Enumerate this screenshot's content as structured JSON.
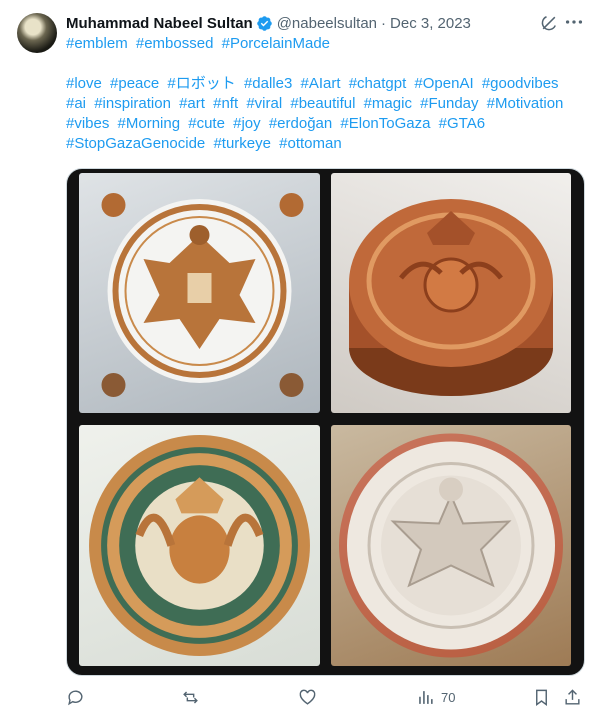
{
  "author": {
    "name": "Muhammad Nabeel Sultan",
    "handle": "@nabeelsultan",
    "date": "Dec 3, 2023",
    "dot": "·"
  },
  "post": {
    "hashtags_line1": [
      "#emblem",
      "#embossed",
      "#PorcelainMade"
    ],
    "hashtags_rest": [
      "#love",
      "#peace",
      "#ロボット",
      "#dalle3",
      "#AIart",
      "#chatgpt",
      "#OpenAI",
      "#goodvibes",
      "#ai",
      "#inspiration",
      "#art",
      "#nft",
      "#viral",
      "#beautiful",
      "#magic",
      "#Funday",
      "#Motivation",
      "#vibes",
      "#Morning",
      "#cute",
      "#joy",
      "#erdoğan",
      "#ElonToGaza",
      "#GTA6",
      "#StopGazaGenocide",
      "#turkeye",
      "#ottoman"
    ]
  },
  "actions": {
    "views": "70"
  },
  "colors": {
    "link": "#1d9bf0",
    "muted": "#536471",
    "verified": "#1d9bf0"
  },
  "icons": [
    "verified-badge-icon",
    "grok-icon",
    "more-icon",
    "reply-icon",
    "repost-icon",
    "like-icon",
    "views-icon",
    "bookmark-icon",
    "share-icon"
  ]
}
